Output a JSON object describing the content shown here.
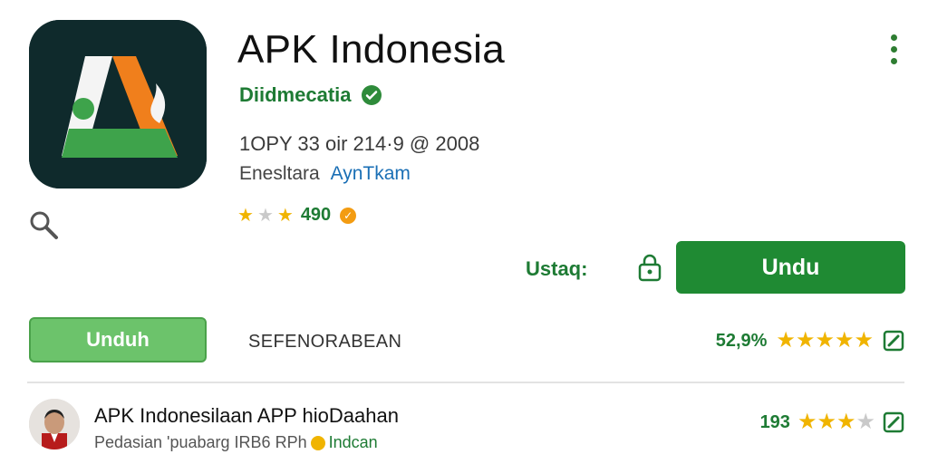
{
  "app": {
    "title": "APK Indonesia",
    "developer": "Diidmecatia",
    "meta_line": "1OPY 33 oir 214·9 @ 2008",
    "category_label": "Enesltara",
    "category_link": "AynTkam",
    "rating_count": "490"
  },
  "icons": {
    "app_icon": "app-logo-icon",
    "search": "search-icon",
    "verified": "verified-icon",
    "more": "more-vertical-icon",
    "lock": "lock-icon",
    "edit": "edit-icon"
  },
  "actions": {
    "status_label": "Ustaq:",
    "install_label": "Undu",
    "download_label": "Unduh",
    "section_label": "SEFENORABEAN"
  },
  "stats": {
    "percent": "52,9%",
    "stars": 5
  },
  "review": {
    "title": "APK Indonesilaan APP hioDaahan",
    "subtitle": "Pedasian 'puabarg IRB6 RPh",
    "tag": "Indcan",
    "count": "193",
    "stars": 3
  },
  "colors": {
    "brand_green": "#1f8a33",
    "light_green": "#6cc36b",
    "star": "#f0b400",
    "link_blue": "#1a6fb5"
  }
}
